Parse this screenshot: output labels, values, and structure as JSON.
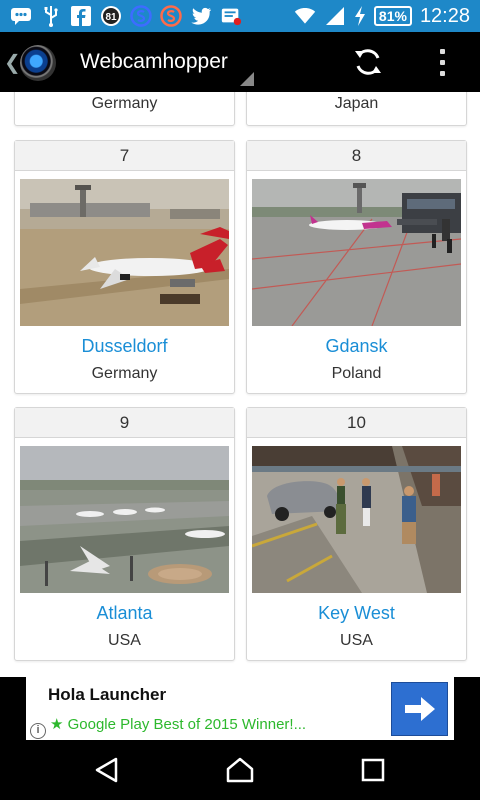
{
  "status_bar": {
    "icons": [
      "chat-icon",
      "usb-icon",
      "facebook-icon",
      "badge-81-icon",
      "s-blue-icon",
      "s-red-icon",
      "twitter-icon",
      "tasks-icon",
      "wifi-icon",
      "signal-icon",
      "charging-icon"
    ],
    "notif_badge": "81",
    "battery": "81%",
    "time": "12:28",
    "colors": {
      "bar": "#1e88c8"
    }
  },
  "action_bar": {
    "title": "Webcamhopper"
  },
  "cards": [
    {
      "number": "",
      "city": "",
      "country": "Germany",
      "image": "partial"
    },
    {
      "number": "",
      "city": "",
      "country": "Japan",
      "image": "partial"
    },
    {
      "number": "7",
      "city": "Dusseldorf",
      "country": "Germany",
      "image": "airport-apron-airberlin-plane"
    },
    {
      "number": "8",
      "city": "Gdansk",
      "country": "Poland",
      "image": "airport-apron-wizzair-plane"
    },
    {
      "number": "9",
      "city": "Atlanta",
      "country": "USA",
      "image": "airport-aerial-delta-planes"
    },
    {
      "number": "10",
      "city": "Key West",
      "country": "USA",
      "image": "street-with-tourists-and-car"
    }
  ],
  "ad": {
    "title": "Hola Launcher",
    "subtitle": "★ Google Play Best of 2015 Winner!...",
    "info": "i",
    "colors": {
      "subtitle": "#2db82d",
      "button": "#2d6fd1"
    }
  },
  "nav_bar": {
    "buttons": [
      "back-icon",
      "home-icon",
      "recents-icon"
    ]
  },
  "colors": {
    "link": "#1a8ed6",
    "accent": "#1e88c8"
  }
}
